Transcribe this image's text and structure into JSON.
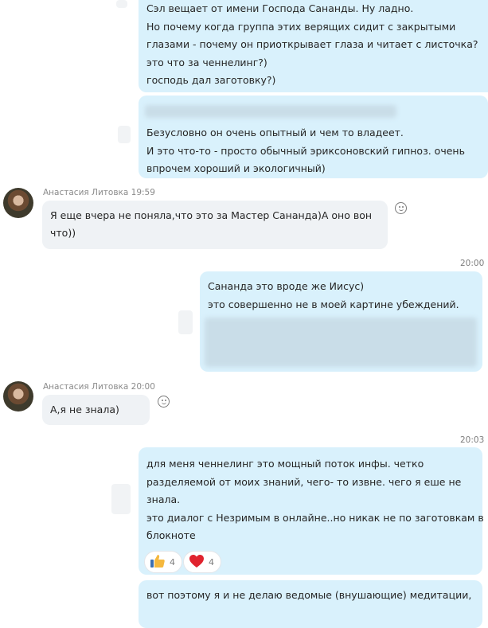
{
  "messages": {
    "m1": {
      "lines": [
        "Сэл вещает от имени Господа Сананды. Ну ладно.",
        "Но почему когда группа этих верящих сидит с закрытыми",
        "глазами - почему он приоткрывает глаза и читает с листочка?",
        "это что за ченнелинг?)",
        "господь дал заготовку?)"
      ]
    },
    "m2": {
      "lines": [
        "Безусловно он очень опытный и чем то владеет.",
        "И это что-то - просто обычный эриксоновский гипноз. очень",
        "впрочем хороший и экологичный)"
      ]
    },
    "m3": {
      "sender": "Анастасия Литовка",
      "time": "19:59",
      "lines": [
        "Я еще вчера не поняла,что это за Мастер Сананда)А оно вон",
        "что))"
      ]
    },
    "m4": {
      "time": "20:00",
      "lines": [
        "Сананда это вроде же Иисус)",
        "это совершенно не в моей картине убеждений."
      ]
    },
    "m5": {
      "sender": "Анастасия Литовка",
      "time": "20:00",
      "lines": [
        "А,я не знала)"
      ]
    },
    "m6": {
      "time": "20:03",
      "lines": [
        "для меня ченнелинг это мощный поток инфы. четко",
        "разделяемой от моих знаний, чего- то извне. чего я еше не",
        "знала.",
        "это диалог с Незримым в онлайне..но никак не по заготовкам в",
        "блокноте"
      ],
      "reactions": [
        {
          "icon": "thumbs-up-icon",
          "count": "4"
        },
        {
          "icon": "heart-icon",
          "count": "4"
        }
      ]
    },
    "m7": {
      "lines": [
        "вот поэтому я и не делаю ведомые (внушающие) медитации,"
      ]
    }
  },
  "colors": {
    "outgoing_bubble": "#d9f1fc",
    "incoming_bubble": "#eff2f5",
    "heart": "#e0232e",
    "thumbs": "#f5b83d"
  }
}
